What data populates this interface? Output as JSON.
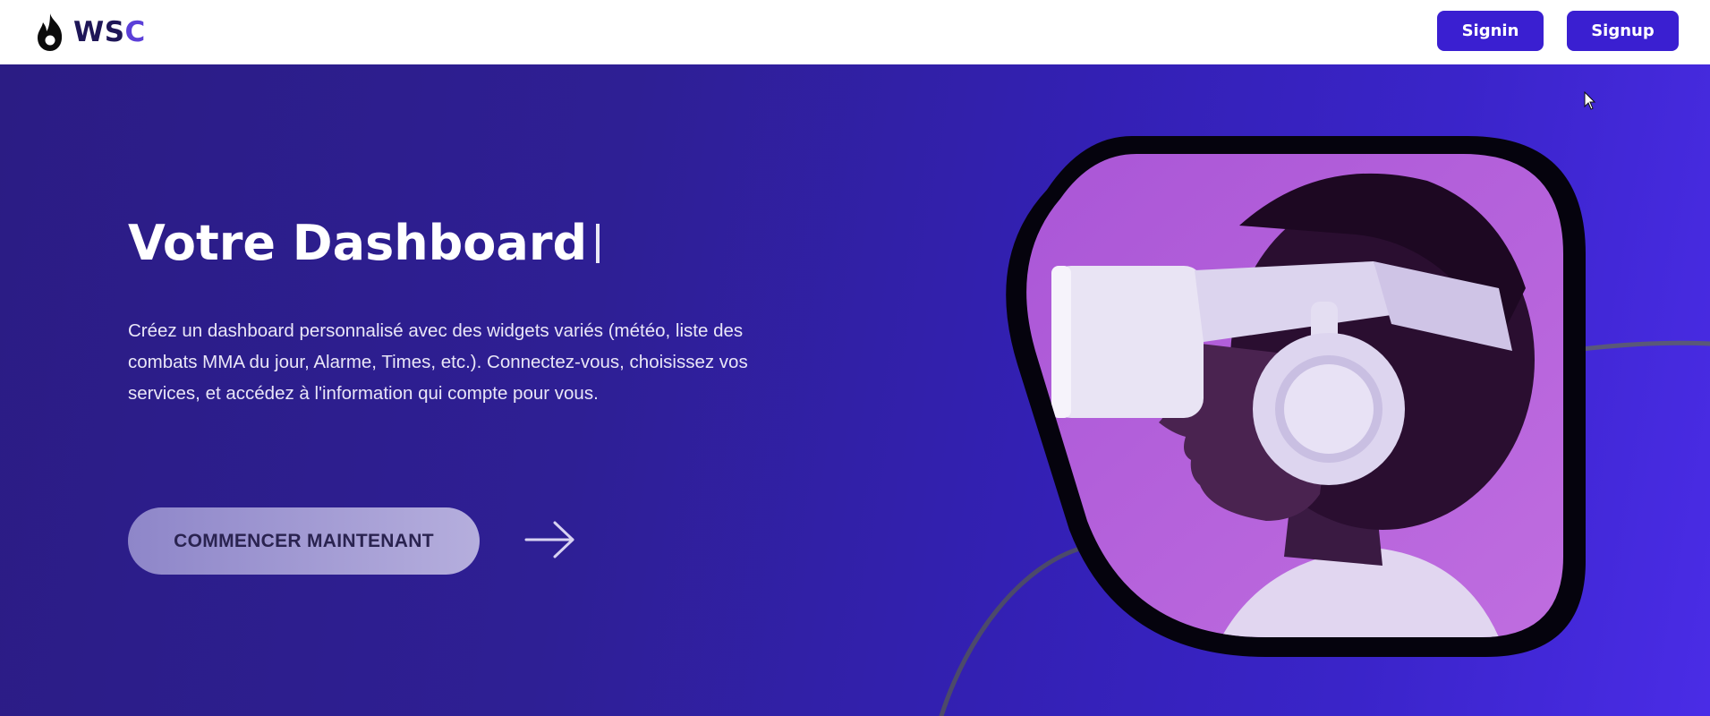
{
  "header": {
    "logo_text_main": "WS",
    "logo_text_accent": "C",
    "signin_label": "Signin",
    "signup_label": "Signup"
  },
  "hero": {
    "title": "Votre Dashboard",
    "description": "Créez un dashboard personnalisé avec des widgets variés (météo, liste des combats MMA du jour, Alarme, Times, etc.). Connectez-vous, choisissez vos services, et accédez à l'information qui compte pour vous.",
    "cta_label": "COMMENCER MAINTENANT",
    "image_subject": "person wearing VR headset and headphones"
  },
  "icons": {
    "logo": "flame-icon",
    "cta_arrow": "arrow-right-icon",
    "cursor": "mouse-cursor-icon"
  },
  "colors": {
    "brand_dark": "#1e1657",
    "brand_accent": "#5b3fd8",
    "button_primary": "#3a1fd1",
    "hero_start": "#2b1c84",
    "hero_end": "#4a2ce6",
    "image_background": "#b25ed8",
    "frame": "#05030d"
  }
}
